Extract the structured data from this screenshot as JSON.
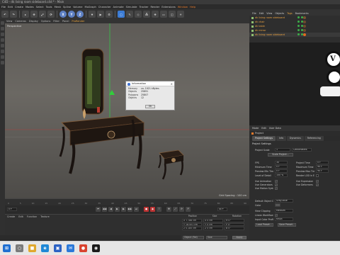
{
  "window": {
    "title": "C4D - dk living room sideboard.c4d * - Main"
  },
  "menubar": [
    "File",
    "Edit",
    "Create",
    "Modes",
    "Select",
    "Tools",
    "Mesh",
    "Spline",
    "Volume",
    "MoGraph",
    "Character",
    "Animate",
    "Simulate",
    "Tracker",
    "Render",
    "Extensions",
    "Window",
    "Help"
  ],
  "menubar_highlight": [
    "Window",
    "Help"
  ],
  "toolbar": {
    "xyz": [
      "X",
      "Y",
      "Z"
    ]
  },
  "viewport": {
    "menu": [
      "View",
      "Cameras",
      "Display",
      "Options",
      "Filter",
      "Panel",
      "ProRender"
    ],
    "active_menu": "ProRender",
    "label": "Perspective",
    "grid_spacing": "Grid Spacing : 100 cm"
  },
  "info_dialog": {
    "title": "Information",
    "rows": [
      {
        "k": "Memory",
        "v": "ca. 1921 kBytes"
      },
      {
        "k": "Objects",
        "v": "25891"
      },
      {
        "k": "Polygons",
        "v": "25807"
      },
      {
        "k": "Objects",
        "v": "12"
      }
    ],
    "ok_label": "Ok"
  },
  "timeline": {
    "ticks": [
      "0",
      "5",
      "10",
      "15",
      "20",
      "25",
      "30",
      "35",
      "40",
      "45",
      "50",
      "55",
      "60",
      "65",
      "70",
      "75",
      "80",
      "85",
      "90"
    ]
  },
  "transport": {
    "frame": "0 F",
    "end_frame": "90 F"
  },
  "material_panel": {
    "menu": [
      "Create",
      "Edit",
      "Function",
      "Texture"
    ]
  },
  "coord_panel": {
    "headers": [
      "Position",
      "Size",
      "Rotation"
    ],
    "rows": [
      [
        "X 7.786 cm",
        "X 0 cm",
        "H 0°"
      ],
      [
        "Y 18.451 cm",
        "Y 0 cm",
        "P 0°"
      ],
      [
        "Z 0.185 cm",
        "Z 0 cm",
        "B 0°"
      ]
    ],
    "mode_select": "Object (Rel)",
    "size_select": "Size",
    "apply_label": "Apply"
  },
  "object_manager": {
    "menu": [
      "File",
      "Edit",
      "View",
      "Objects",
      "Tags",
      "Bookmarks"
    ],
    "active_menu": "Tags",
    "objects": [
      {
        "name": "dk living room sideboard",
        "tag_color": "#7a5230"
      },
      {
        "name": "dk chair",
        "tag_color": "#6e4b2c"
      },
      {
        "name": "dk table",
        "tag_color": "#6e4b2c"
      },
      {
        "name": "dk mirror",
        "tag_color": "#6e4b2c"
      },
      {
        "name": "dk living room sideboard",
        "tag_color": "#e06b1f"
      }
    ]
  },
  "attributes": {
    "menu": [
      "Mode",
      "Edit",
      "User Data"
    ],
    "object_label": "Project",
    "tabs": [
      "Project Settings",
      "Info",
      "Dynamics",
      "Referencing"
    ],
    "section_title": "Project Settings",
    "project_scale": {
      "label": "Project Scale",
      "value": "1",
      "unit": "Centimeters"
    },
    "scale_button": "Scale Project...",
    "fields_left": [
      {
        "label": "FPS",
        "value": "30"
      },
      {
        "label": "Minimum Time",
        "value": "0 F"
      },
      {
        "label": "Preview Min Time",
        "value": "0 F"
      },
      {
        "label": "Level of Detail",
        "value": "100 %"
      }
    ],
    "fields_right": [
      {
        "label": "Project Time",
        "value": "0 F"
      },
      {
        "label": "Maximum Time",
        "value": "90 F"
      },
      {
        "label": "Preview Max Time",
        "value": "90 F"
      },
      {
        "label": "Render LOD in Editor",
        "value": ""
      }
    ],
    "checks_left": [
      "Use Animation",
      "Use Generators",
      "Use Motion System"
    ],
    "checks_right": [
      "Use Expression",
      "Use Deformers"
    ],
    "default_color": {
      "label": "Default Object Color",
      "value": "Gray-Blue"
    },
    "color_label": "Color",
    "view_clipping": {
      "label": "View Clipping",
      "value": "Medium"
    },
    "linear_workflow": "Linear Workflow",
    "input_color_profile": {
      "label": "Input Color Profile",
      "value": "sRGB"
    },
    "load_preset": "Load Preset...",
    "save_preset": "Save Preset..."
  },
  "taskbar": {
    "apps": [
      {
        "name": "windows",
        "color": "#1f6fd1",
        "glyph": "⊞"
      },
      {
        "name": "search",
        "color": "#7a7a7a",
        "glyph": "○"
      },
      {
        "name": "explorer",
        "color": "#e0a82e",
        "glyph": "■"
      },
      {
        "name": "edge",
        "color": "#1f88d6",
        "glyph": "e"
      },
      {
        "name": "store",
        "color": "#2c62c4",
        "glyph": "▣"
      },
      {
        "name": "mail",
        "color": "#2b79d9",
        "glyph": "✉"
      },
      {
        "name": "chrome",
        "color": "#d9432f",
        "glyph": "●"
      },
      {
        "name": "cinema4d",
        "color": "#1a1a1a",
        "glyph": "◉"
      }
    ]
  }
}
